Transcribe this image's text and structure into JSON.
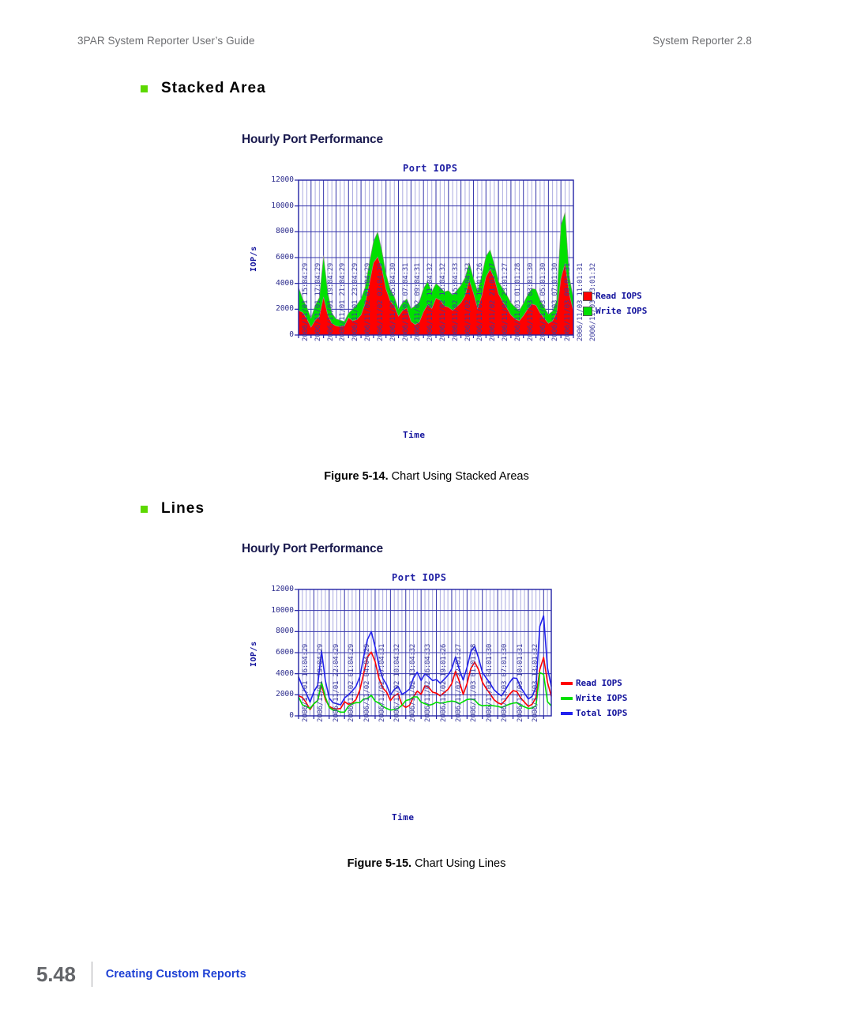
{
  "header": {
    "left": "3PAR System Reporter User’s Guide",
    "right": "System Reporter 2.8"
  },
  "sections": [
    {
      "id": "stacked",
      "label": "Stacked Area",
      "bullet_color": "#5cd800"
    },
    {
      "id": "lines",
      "label": "Lines",
      "bullet_color": "#5cd800"
    }
  ],
  "captions": {
    "fig_514_num": "Figure 5-14.",
    "fig_514_text": "Chart Using Stacked Areas",
    "fig_515_num": "Figure 5-15.",
    "fig_515_text": "Chart Using Lines"
  },
  "footer": {
    "page_number": "5.48",
    "chapter": "Creating Custom Reports",
    "chapter_color": "#1c3fd4"
  },
  "charts": {
    "stacked": {
      "heading": "Hourly Port Performance",
      "title": "Port IOPS",
      "ylabel": "IOP/s",
      "xlabel": "Time",
      "legend": [
        {
          "label": "Read IOPS",
          "color": "#ff0000"
        },
        {
          "label": "Write IOPS",
          "color": "#00e000"
        }
      ]
    },
    "lines": {
      "heading": "Hourly Port Performance",
      "title": "Port IOPS",
      "ylabel": "IOP/s",
      "xlabel": "Time",
      "legend": [
        {
          "label": "Read IOPS",
          "color": "#ff0000"
        },
        {
          "label": "Write IOPS",
          "color": "#00e000"
        },
        {
          "label": "Total IOPS",
          "color": "#2222ee"
        }
      ]
    }
  },
  "chart_data": [
    {
      "type": "area",
      "stacked": true,
      "title": "Port IOPS",
      "subtitle": "Hourly Port Performance",
      "xlabel": "Time",
      "ylabel": "IOP/s",
      "ylim": [
        0,
        12000
      ],
      "yticks": [
        0,
        2000,
        4000,
        6000,
        8000,
        10000,
        12000
      ],
      "grid": true,
      "legend_position": "right",
      "tick_labels": [
        "2006/11/01 15:04:29",
        "2006/11/01 17:04:29",
        "2006/11/01 19:04:29",
        "2006/11/01 21:04:29",
        "2006/11/01 23:04:29",
        "2006/11/02 01:04:29",
        "2006/11/02 03:04:29",
        "2006/11/02 05:04:30",
        "2006/11/02 07:04:31",
        "2006/11/02 09:04:31",
        "2006/11/02 11:04:32",
        "2006/11/02 13:04:32",
        "2006/11/02 15:04:33",
        "2006/11/02 17:04:33",
        "2006/11/02 19:01:26",
        "2006/11/02 21:01:27",
        "2006/11/02 23:01:27",
        "2006/11/03 01:01:28",
        "2006/11/03 03:01:30",
        "2006/11/03 05:01:30",
        "2006/11/03 07:01:30",
        "2006/11/03 09:01:31",
        "2006/11/03 11:01:31",
        "2006/11/03 13:01:32"
      ],
      "series": [
        {
          "name": "Read IOPS",
          "color": "#ff0000",
          "values": [
            1900,
            1750,
            1250,
            600,
            1150,
            1450,
            2950,
            1550,
            900,
            700,
            650,
            700,
            1350,
            1100,
            1200,
            1550,
            2450,
            4000,
            5600,
            6050,
            5150,
            3550,
            2650,
            2250,
            1450,
            1900,
            2100,
            1050,
            800,
            1000,
            1800,
            2350,
            2050,
            2850,
            2700,
            2250,
            2150,
            1900,
            2200,
            2500,
            3050,
            4250,
            3250,
            2050,
            3050,
            4500,
            5100,
            4400,
            3200,
            2600,
            2100,
            1550,
            1250,
            1100,
            1500,
            2000,
            2400,
            2300,
            1700,
            1300,
            900,
            1100,
            1750,
            4400,
            5550,
            3200,
            1850
          ]
        },
        {
          "name": "Write IOPS",
          "color": "#00e000",
          "values": [
            1800,
            1050,
            900,
            700,
            1150,
            1450,
            3200,
            1800,
            800,
            550,
            500,
            350,
            350,
            900,
            1150,
            1250,
            1250,
            1600,
            1650,
            1950,
            1400,
            1200,
            900,
            700,
            550,
            600,
            700,
            1000,
            1450,
            1550,
            1800,
            1800,
            1300,
            1150,
            1000,
            1100,
            1300,
            1200,
            1250,
            1350,
            1400,
            1350,
            1150,
            1350,
            1550,
            1600,
            1500,
            1100,
            950,
            1000,
            1000,
            950,
            900,
            800,
            950,
            1100,
            1200,
            1250,
            1000,
            850,
            700,
            750,
            950,
            4100,
            3950,
            1350,
            950
          ]
        }
      ]
    },
    {
      "type": "line",
      "title": "Port IOPS",
      "subtitle": "Hourly Port Performance",
      "xlabel": "Time",
      "ylabel": "IOP/s",
      "ylim": [
        0,
        12000
      ],
      "yticks": [
        0,
        2000,
        4000,
        6000,
        8000,
        10000,
        12000
      ],
      "grid": true,
      "legend_position": "right",
      "tick_labels": [
        "2006/11/01 16:04:29",
        "2006/11/01 19:04:29",
        "2006/11/01 22:04:29",
        "2006/11/02 01:04:29",
        "2006/11/02 04:04:29",
        "2006/11/02 07:04:31",
        "2006/11/02 10:04:32",
        "2006/11/02 13:04:32",
        "2006/11/02 16:04:33",
        "2006/11/02 19:01:26",
        "2006/11/02 22:01:27",
        "2006/11/03 01:01:28",
        "2006/11/03 04:01:30",
        "2006/11/03 07:01:30",
        "2006/11/03 10:01:31",
        "2006/11/03 13:01:32"
      ],
      "series": [
        {
          "name": "Read IOPS",
          "color": "#ff0000",
          "values": [
            1900,
            1750,
            1250,
            600,
            1150,
            1450,
            2950,
            1550,
            900,
            700,
            650,
            700,
            1350,
            1100,
            1200,
            1550,
            2450,
            4000,
            5600,
            6050,
            5150,
            3550,
            2650,
            2250,
            1450,
            1900,
            2100,
            1050,
            800,
            1000,
            1800,
            2350,
            2050,
            2850,
            2700,
            2250,
            2150,
            1900,
            2200,
            2500,
            3050,
            4250,
            3250,
            2050,
            3050,
            4500,
            5100,
            4400,
            3200,
            2600,
            2100,
            1550,
            1250,
            1100,
            1500,
            2000,
            2400,
            2300,
            1700,
            1300,
            900,
            1100,
            1750,
            4400,
            5550,
            3200,
            1850
          ]
        },
        {
          "name": "Write IOPS",
          "color": "#00e000",
          "values": [
            1800,
            1050,
            900,
            700,
            1150,
            1450,
            3200,
            1800,
            800,
            550,
            500,
            350,
            350,
            900,
            1150,
            1250,
            1250,
            1600,
            1650,
            1950,
            1400,
            1200,
            900,
            700,
            550,
            600,
            700,
            1000,
            1450,
            1550,
            1800,
            1800,
            1300,
            1150,
            1000,
            1100,
            1300,
            1200,
            1250,
            1350,
            1400,
            1350,
            1150,
            1350,
            1550,
            1600,
            1500,
            1100,
            950,
            1000,
            1000,
            950,
            900,
            800,
            950,
            1100,
            1200,
            1250,
            1000,
            850,
            700,
            750,
            950,
            4100,
            3950,
            1350,
            950
          ]
        },
        {
          "name": "Total IOPS",
          "color": "#2222ee",
          "values": [
            3700,
            2800,
            2150,
            1300,
            2300,
            2900,
            6150,
            3350,
            1700,
            1250,
            1150,
            1050,
            1700,
            2000,
            2350,
            2800,
            3700,
            5600,
            7250,
            8000,
            6550,
            4750,
            3550,
            2950,
            2000,
            2500,
            2800,
            2050,
            2250,
            2550,
            3600,
            4150,
            3350,
            4000,
            3700,
            3350,
            3450,
            3100,
            3450,
            3850,
            4450,
            5600,
            4400,
            3400,
            4600,
            6100,
            6600,
            5500,
            4150,
            3600,
            3100,
            2500,
            2150,
            1900,
            2450,
            3100,
            3600,
            3550,
            2700,
            2150,
            1600,
            1850,
            2700,
            8500,
            9500,
            4550,
            2800
          ]
        }
      ]
    }
  ]
}
